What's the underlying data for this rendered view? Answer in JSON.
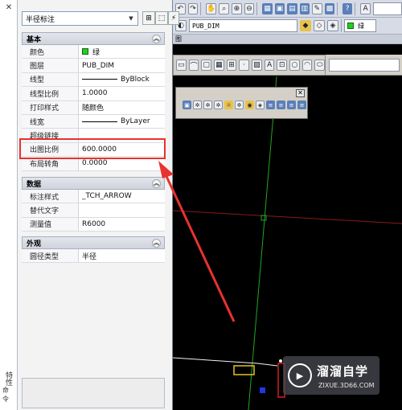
{
  "palette": {
    "close_glyph": "✕",
    "side_vertical_label": "特性",
    "side_bottom_label": "命令",
    "type_select": "半径标注",
    "sections": [
      {
        "title": "基本",
        "rows": [
          {
            "name": "颜色",
            "value": "绿",
            "swatch": "#1fd11f"
          },
          {
            "name": "图层",
            "value": "PUB_DIM"
          },
          {
            "name": "线型",
            "value": "ByBlock",
            "line": true
          },
          {
            "name": "线型比例",
            "value": "1.0000"
          },
          {
            "name": "打印样式",
            "value": "随颜色"
          },
          {
            "name": "线宽",
            "value": "ByLayer",
            "line": true
          },
          {
            "name": "超级链接",
            "value": ""
          },
          {
            "name": "出图比例",
            "value": "600.0000"
          },
          {
            "name": "布局转角",
            "value": "0.0000"
          }
        ]
      },
      {
        "title": "数据",
        "rows": [
          {
            "name": "标注样式",
            "value": "_TCH_ARROW"
          },
          {
            "name": "替代文字",
            "value": ""
          },
          {
            "name": "测量值",
            "value": "R6000"
          }
        ]
      },
      {
        "title": "外观",
        "rows": [
          {
            "name": "圆径类型",
            "value": "半径"
          }
        ]
      }
    ]
  },
  "toolbar": {
    "layer_select": "PUB_DIM",
    "color_select": "绿",
    "small_label": "图"
  },
  "watermark": {
    "title": "溜溜自学",
    "sub": "ZIXUE.3D66.COM"
  },
  "colors": {
    "highlight": "#e8322e",
    "axis_green": "#1fa81f",
    "axis_red": "#8b1a1a"
  }
}
